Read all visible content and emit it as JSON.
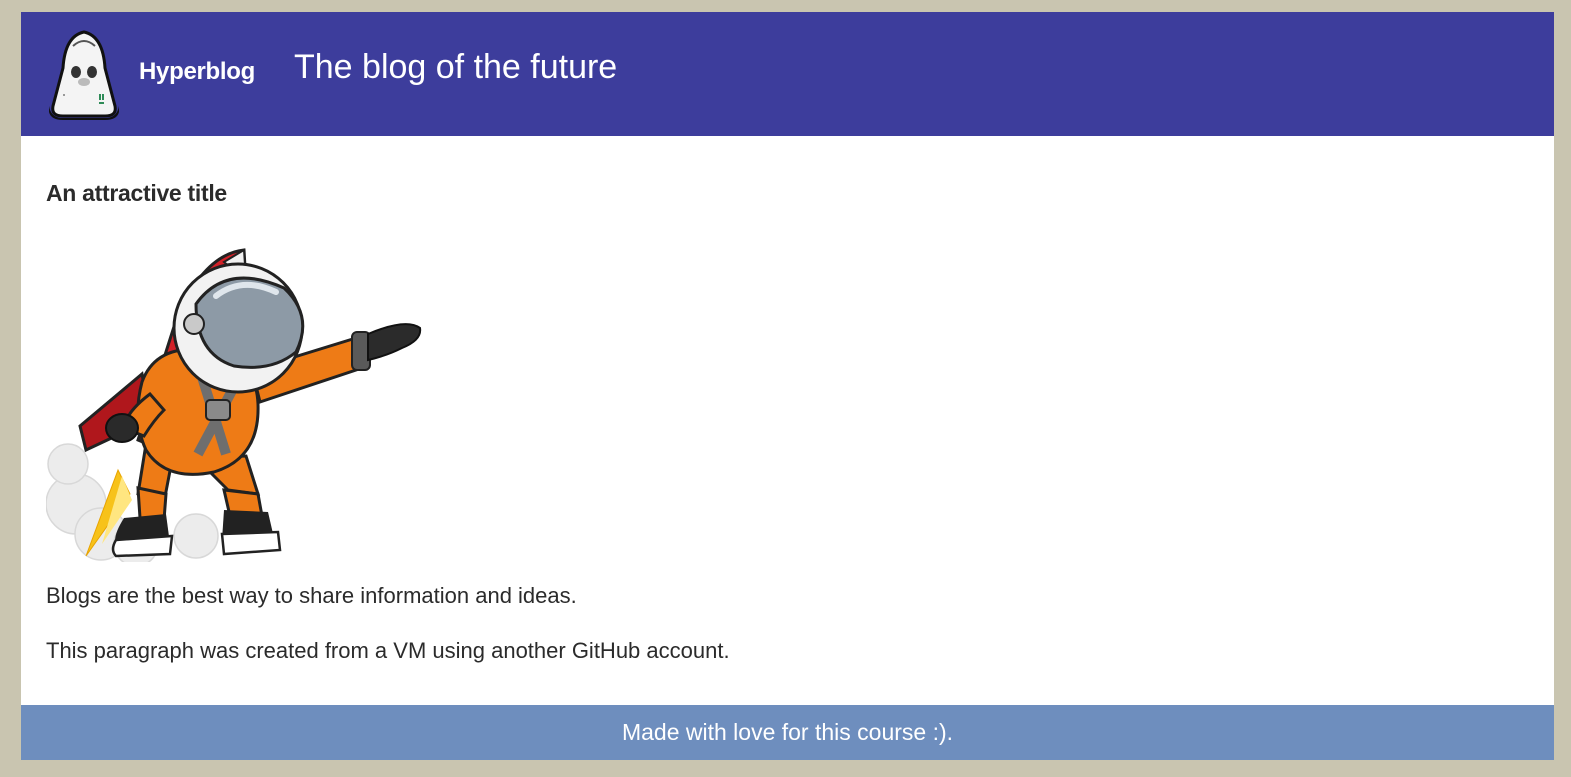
{
  "header": {
    "logo_icon": "space-capsule-logo-icon",
    "brand": "Hyperblog",
    "tagline": "The blog of the future",
    "background_color": "#3d3d9c"
  },
  "post": {
    "title": "An attractive title",
    "image_icon": "astronaut-jetpack-illustration",
    "paragraphs": [
      "Blogs are the best way to share information and ideas.",
      "This paragraph was created from a VM using another GitHub account."
    ]
  },
  "footer": {
    "text": "Made with love for this course :).",
    "background_color": "#6e8ebe"
  },
  "page_background_color": "#c9c5b0"
}
